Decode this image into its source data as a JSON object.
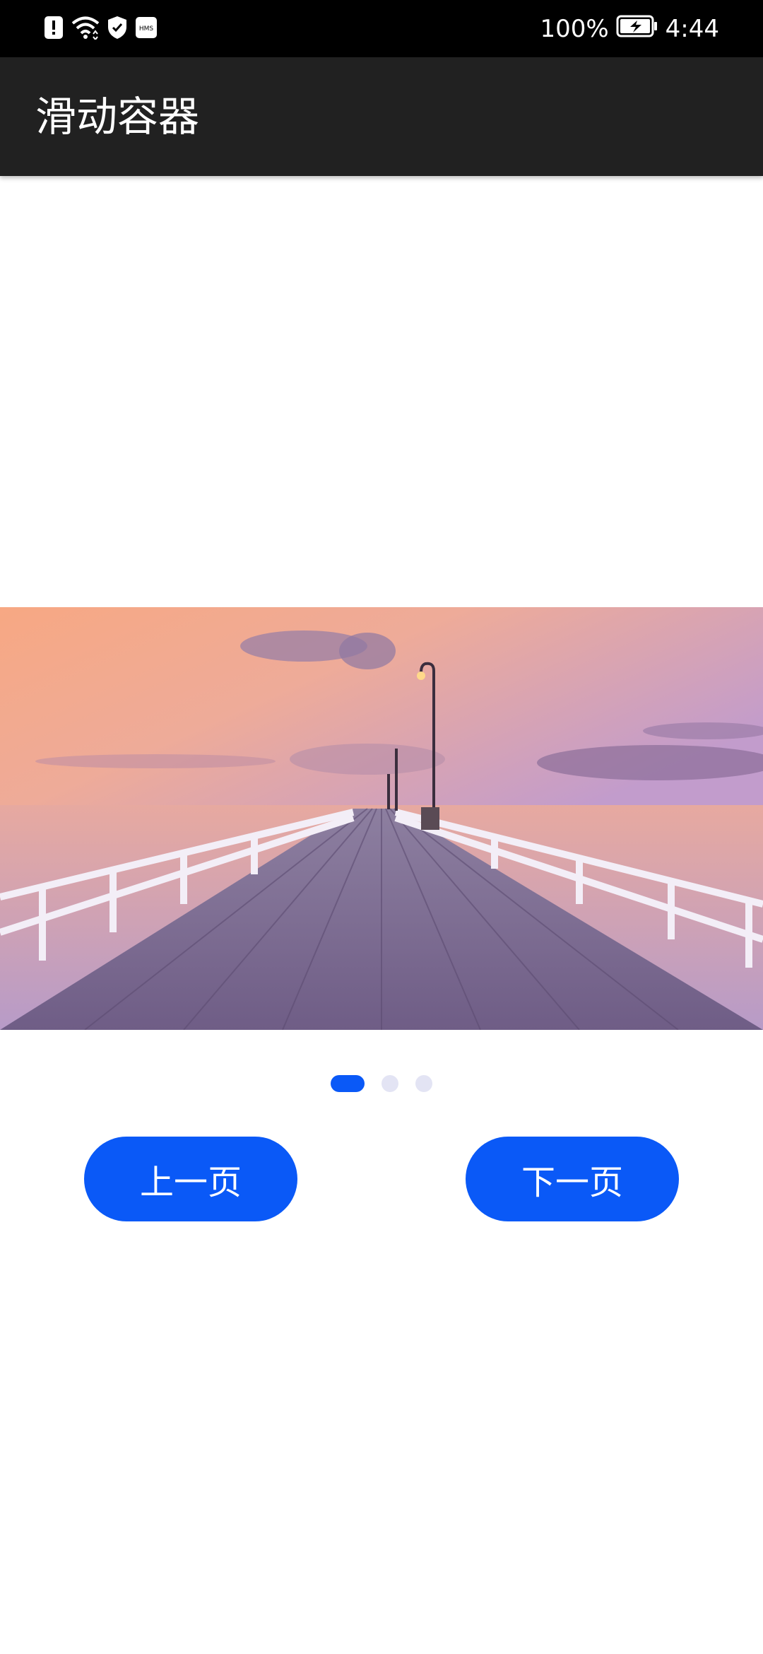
{
  "status_bar": {
    "battery_percent": "100%",
    "time": "4:44",
    "icons": [
      "alert-icon",
      "wifi-icon",
      "shield-check-icon",
      "hms-icon"
    ],
    "hms_label": "HMS"
  },
  "app_bar": {
    "title": "滑动容器"
  },
  "swiper": {
    "image_subject": "pier-sunset-image",
    "page_count": 3,
    "active_index": 0
  },
  "buttons": {
    "prev_label": "上一页",
    "next_label": "下一页"
  },
  "colors": {
    "accent": "#0a59f7",
    "app_bar": "#212121",
    "dot_inactive": "#e3e4f4"
  }
}
